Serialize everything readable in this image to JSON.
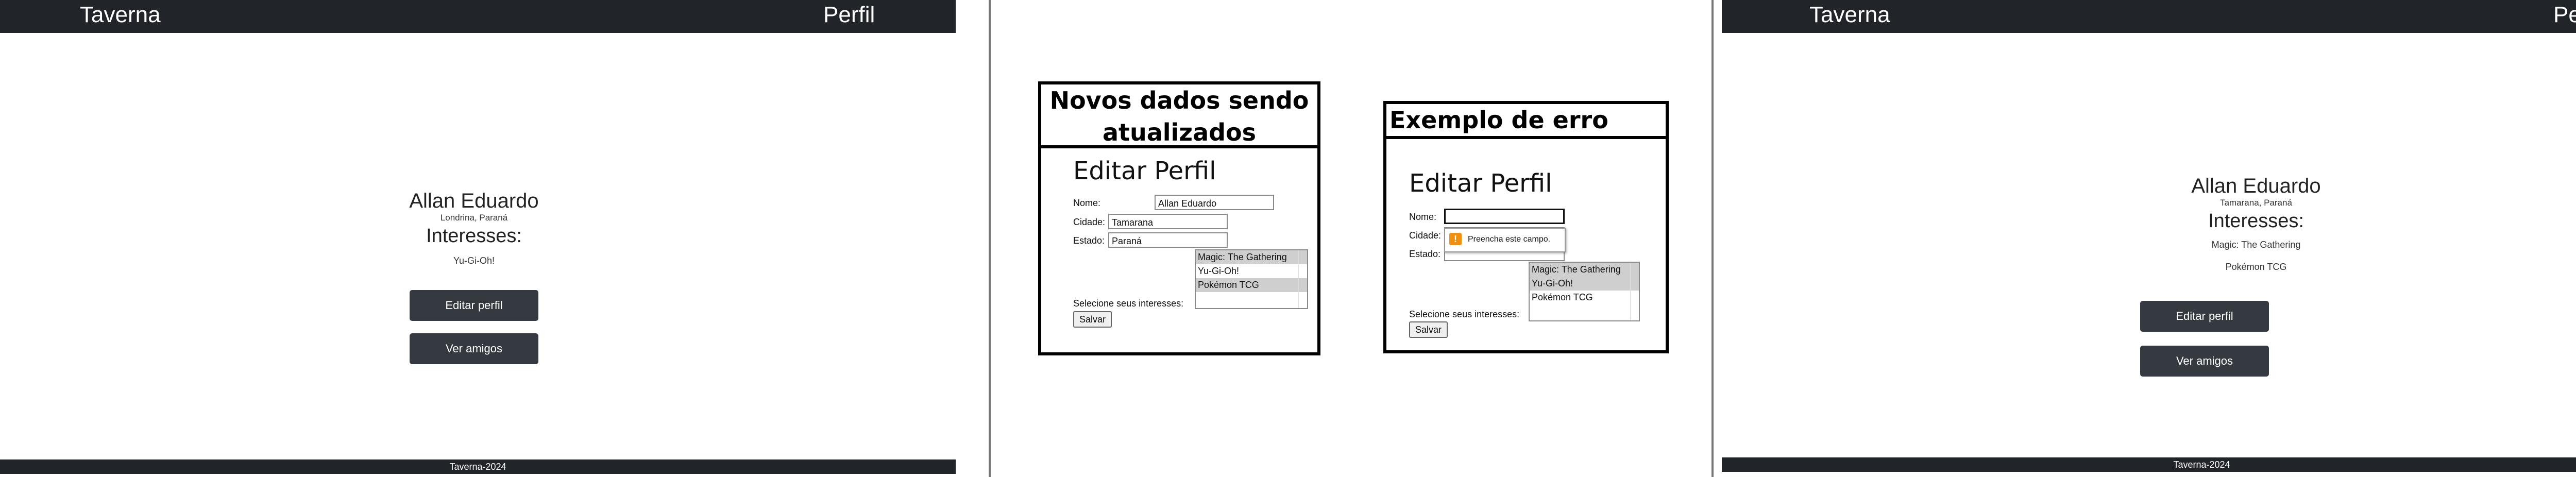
{
  "panel_1": {
    "topbar": {
      "brand": "Taverna",
      "perfil": "Perfil"
    },
    "profile": {
      "name": "Allan Eduardo",
      "location": "Londrina, Paraná",
      "interests_title": "Interesses:",
      "interests": [
        "Yu-Gi-Oh!"
      ]
    },
    "buttons": {
      "edit": "Editar perfil",
      "friends": "Ver amigos"
    },
    "footer": "Taverna-2024"
  },
  "card_update": {
    "heading_line1": "Novos dados sendo",
    "heading_line2": "atualizados",
    "form": {
      "title": "Editar Perfil",
      "nome_label": "Nome:",
      "nome_value": "Allan Eduardo",
      "cidade_label": "Cidade:",
      "cidade_value": "Tamarana",
      "estado_label": "Estado:",
      "estado_value": "Paraná",
      "options": [
        "Magic: The Gathering",
        "Yu-Gi-Oh!",
        "Pokémon TCG"
      ],
      "interests_label": "Selecione seus interesses:",
      "save": "Salvar"
    }
  },
  "card_error": {
    "heading": "Exemplo de erro",
    "form": {
      "title": "Editar Perfil",
      "nome_label": "Nome:",
      "nome_value": "",
      "cidade_label": "Cidade:",
      "estado_label": "Estado:",
      "tooltip": "Preencha este campo.",
      "options": [
        "Magic: The Gathering",
        "Yu-Gi-Oh!",
        "Pokémon TCG"
      ],
      "interests_label": "Selecione seus interesses:",
      "save": "Salvar"
    }
  },
  "panel_3": {
    "topbar": {
      "brand": "Taverna",
      "perfil": "Perfil"
    },
    "profile": {
      "name": "Allan Eduardo",
      "location": "Tamarana, Paraná",
      "interests_title": "Interesses:",
      "interests": [
        "Magic: The Gathering",
        "Pokémon TCG"
      ]
    },
    "buttons": {
      "edit": "Editar perfil",
      "friends": "Ver amigos"
    },
    "footer": "Taverna-2024"
  },
  "colors": {
    "navbar": "#212529",
    "button": "#343a40",
    "selected_option": "#cfcfcf",
    "warning": "#f0900e"
  }
}
